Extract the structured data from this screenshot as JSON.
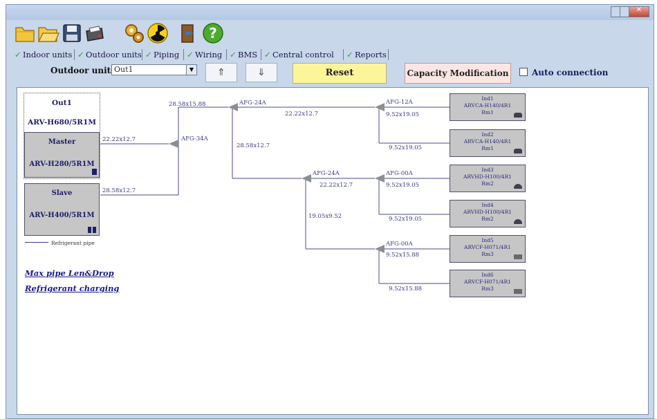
{
  "toolbar": {
    "buttons": [
      "new-file-icon",
      "open-folder-icon",
      "save-icon",
      "print-icon",
      "settings-gears-icon",
      "radiation-icon",
      "exit-door-icon",
      "help-icon"
    ]
  },
  "tabs": [
    {
      "label": "Indoor units"
    },
    {
      "label": "Outdoor units"
    },
    {
      "label": "Piping"
    },
    {
      "label": "Wiring"
    },
    {
      "label": "BMS"
    },
    {
      "label": "Central control"
    },
    {
      "label": "Reports"
    }
  ],
  "controls": {
    "outdoor_units_label": "Outdoor units",
    "outdoor_units_value": "Out1",
    "up_arrow": "⇑",
    "down_arrow": "⇓",
    "reset_label": "Reset",
    "capacity_label": "Capacity Modification",
    "auto_connection_label": "Auto connection"
  },
  "outdoor": {
    "name": "Out1",
    "model": "ARV-H680/5R1M",
    "master_label": "Master",
    "master_model": "ARV-H280/5R1M",
    "slave_label": "Slave",
    "slave_model": "ARV-H400/5R1M"
  },
  "legend": {
    "label": "Refrigerant pipe"
  },
  "links": {
    "max_pipe": "Max pipe Len&Drop",
    "refrigerant_charging": "Refrigerant charging"
  },
  "piping": {
    "master_pipe": "22.22x12.7",
    "slave_pipe": "28.58x12.7",
    "main_pipe": "28.58x15.88",
    "joint_main": "AFG-34A",
    "joint_top": "AFG-24A",
    "pipe_top_to_12a": "22.22x12.7",
    "pipe_top_down": "28.58x12.7",
    "joint_12a": "AFG-12A",
    "pipe_12a_ind1": "9.52x19.05",
    "pipe_12a_ind2": "9.52x19.05",
    "joint_mid": "AFG-24A",
    "pipe_mid_to_00a": "22.22x12.7",
    "pipe_mid_down": "19.05x9.52",
    "joint_00a_upper": "AFG-00A",
    "pipe_ind3": "9.52x19.05",
    "pipe_ind4": "9.52x19.05",
    "joint_00a_lower": "AFG-00A",
    "pipe_ind5": "9.52x15.88",
    "pipe_ind6": "9.52x15.88"
  },
  "indoor_units": [
    {
      "name": "Ind1",
      "model": "ARVCA-H140/4R1",
      "room": "Rm1",
      "icon": "cassette-icon"
    },
    {
      "name": "Ind2",
      "model": "ARVCA-H140/4R1",
      "room": "Rm1",
      "icon": "cassette-icon"
    },
    {
      "name": "Ind3",
      "model": "ARVHD-H100/4R1",
      "room": "Rm2",
      "icon": "duct-icon"
    },
    {
      "name": "Ind4",
      "model": "ARVHD-H100/4R1",
      "room": "Rm2",
      "icon": "duct-icon"
    },
    {
      "name": "Ind5",
      "model": "ARVCF-H071/4R1",
      "room": "Rm3",
      "icon": "floor-ceiling-icon"
    },
    {
      "name": "Ind6",
      "model": "ARVCF-H071/4R1",
      "room": "Rm3",
      "icon": "floor-ceiling-icon"
    }
  ]
}
